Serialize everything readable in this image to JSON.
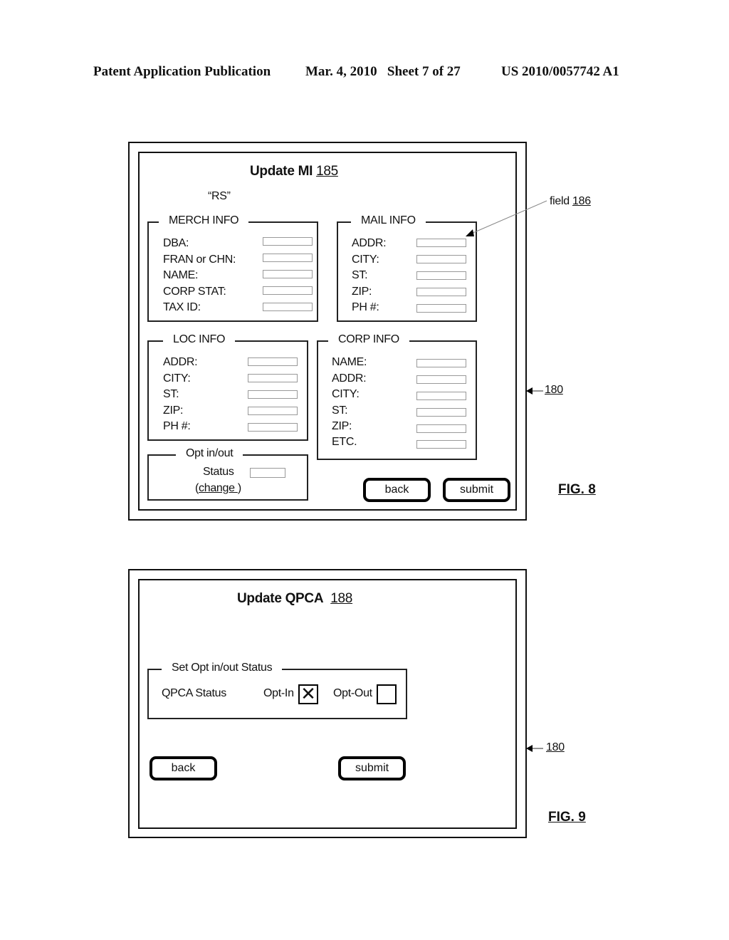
{
  "header": {
    "publication": "Patent Application Publication",
    "date_sheet": "Mar. 4, 2010   Sheet 7 of 27",
    "number": "US 2010/0057742 A1"
  },
  "fig8": {
    "title": "Update MI",
    "title_ref": "185",
    "subtitle": "“RS”",
    "field_callout": {
      "label": "field",
      "ref": "186"
    },
    "screen_ref": "180",
    "fig_label": "FIG. 8",
    "merch_info": {
      "legend": "MERCH INFO",
      "fields": [
        "DBA:",
        "FRAN or CHN:",
        "NAME:",
        "CORP STAT:",
        "TAX ID:"
      ]
    },
    "mail_info": {
      "legend": "MAIL INFO",
      "fields": [
        "ADDR:",
        "CITY:",
        "ST:",
        "ZIP:",
        "PH #:"
      ]
    },
    "loc_info": {
      "legend": "LOC INFO",
      "fields": [
        "ADDR:",
        "CITY:",
        "ST:",
        "ZIP:",
        "PH #:"
      ]
    },
    "corp_info": {
      "legend": "CORP INFO",
      "fields": [
        "NAME:",
        "ADDR:",
        "CITY:",
        "ST:",
        "ZIP:",
        "ETC."
      ]
    },
    "opt": {
      "legend": "Opt in/out",
      "status_label": "Status",
      "change_open": "(",
      "change_link": "change ",
      "change_close": ")"
    },
    "buttons": {
      "back": "back",
      "submit": "submit"
    }
  },
  "fig9": {
    "title": "Update QPCA",
    "title_ref": "188",
    "group_legend": "Set Opt in/out Status",
    "status_label": "QPCA Status",
    "opt_in_label": "Opt-In",
    "opt_in_checked": true,
    "opt_in_mark": "✕",
    "opt_out_label": "Opt-Out",
    "opt_out_checked": false,
    "screen_ref": "180",
    "fig_label": "FIG. 9",
    "buttons": {
      "back": "back",
      "submit": "submit"
    }
  }
}
